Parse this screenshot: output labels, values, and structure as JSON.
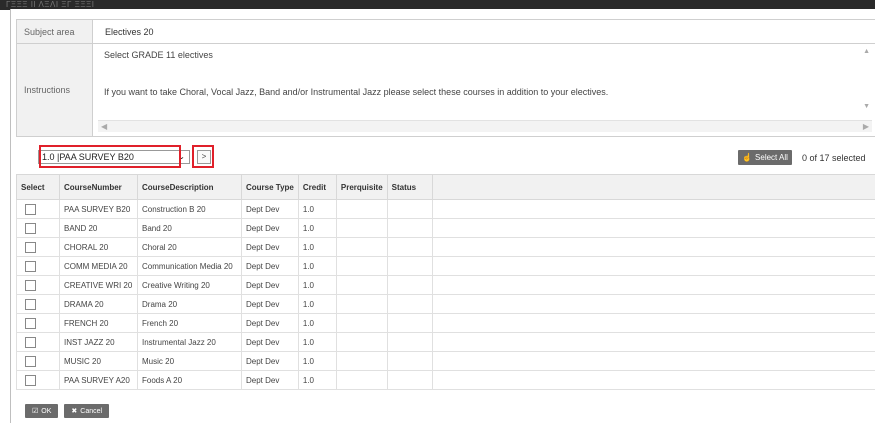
{
  "header": {
    "ghost_title": "ΓΞΞΞ ΙΙ ΛΞΛΙ ΞΓ ΞΞΞΙ"
  },
  "info": {
    "subject_label": "Subject area",
    "subject_value": "Electives 20",
    "instructions_label": "Instructions",
    "instructions_line1": "Select GRADE 11 electives",
    "instructions_line2": "If you want to take Choral, Vocal Jazz, Band and/or Instrumental Jazz please select these courses in addition to your electives."
  },
  "controls": {
    "course_select_value": "1.0 |PAA SURVEY B20",
    "go_button_label": ">",
    "select_all_label": "Select All",
    "selected_count": "0 of 17 selected"
  },
  "table": {
    "columns": [
      "Select",
      "CourseNumber",
      "CourseDescription",
      "Course Type",
      "Credit",
      "Prerquisite",
      "Status"
    ],
    "rows": [
      {
        "number": "PAA SURVEY B20",
        "description": "Construction B 20",
        "type": "Dept Dev",
        "credit": "1.0"
      },
      {
        "number": "BAND 20",
        "description": "Band 20",
        "type": "Dept Dev",
        "credit": "1.0"
      },
      {
        "number": "CHORAL 20",
        "description": "Choral 20",
        "type": "Dept Dev",
        "credit": "1.0"
      },
      {
        "number": "COMM MEDIA 20",
        "description": "Communication Media 20",
        "type": "Dept Dev",
        "credit": "1.0"
      },
      {
        "number": "CREATIVE WRI 20",
        "description": "Creative Writing 20",
        "type": "Dept Dev",
        "credit": "1.0"
      },
      {
        "number": "DRAMA 20",
        "description": "Drama 20",
        "type": "Dept Dev",
        "credit": "1.0"
      },
      {
        "number": "FRENCH 20",
        "description": "French 20",
        "type": "Dept Dev",
        "credit": "1.0"
      },
      {
        "number": "INST JAZZ 20",
        "description": "Instrumental Jazz 20",
        "type": "Dept Dev",
        "credit": "1.0"
      },
      {
        "number": "MUSIC 20",
        "description": "Music 20",
        "type": "Dept Dev",
        "credit": "1.0"
      },
      {
        "number": "PAA SURVEY A20",
        "description": "Foods A 20",
        "type": "Dept Dev",
        "credit": "1.0"
      }
    ]
  },
  "footer": {
    "ok_label": "OK",
    "cancel_label": "Cancel"
  },
  "colors": {
    "highlight": "#e0202a",
    "button": "#6b6b6b",
    "header_bg": "#f1f1f1"
  }
}
